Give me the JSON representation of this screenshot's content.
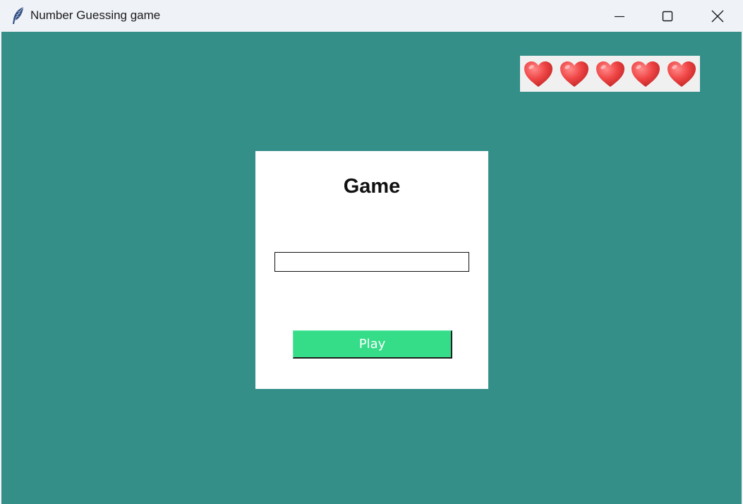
{
  "window": {
    "title": "Number Guessing game",
    "app_icon": "feather-icon",
    "controls": {
      "minimize_icon": "minimize-icon",
      "maximize_icon": "maximize-icon",
      "close_icon": "close-icon"
    }
  },
  "colors": {
    "background": "#358f89",
    "card": "#ffffff",
    "play_button": "#35dd89",
    "heart": "#f04646",
    "lives_panel": "#f0f0f0"
  },
  "lives": {
    "count": 5,
    "icon": "heart-icon"
  },
  "game": {
    "title": "Game",
    "input_value": "",
    "play_label": "Play"
  }
}
